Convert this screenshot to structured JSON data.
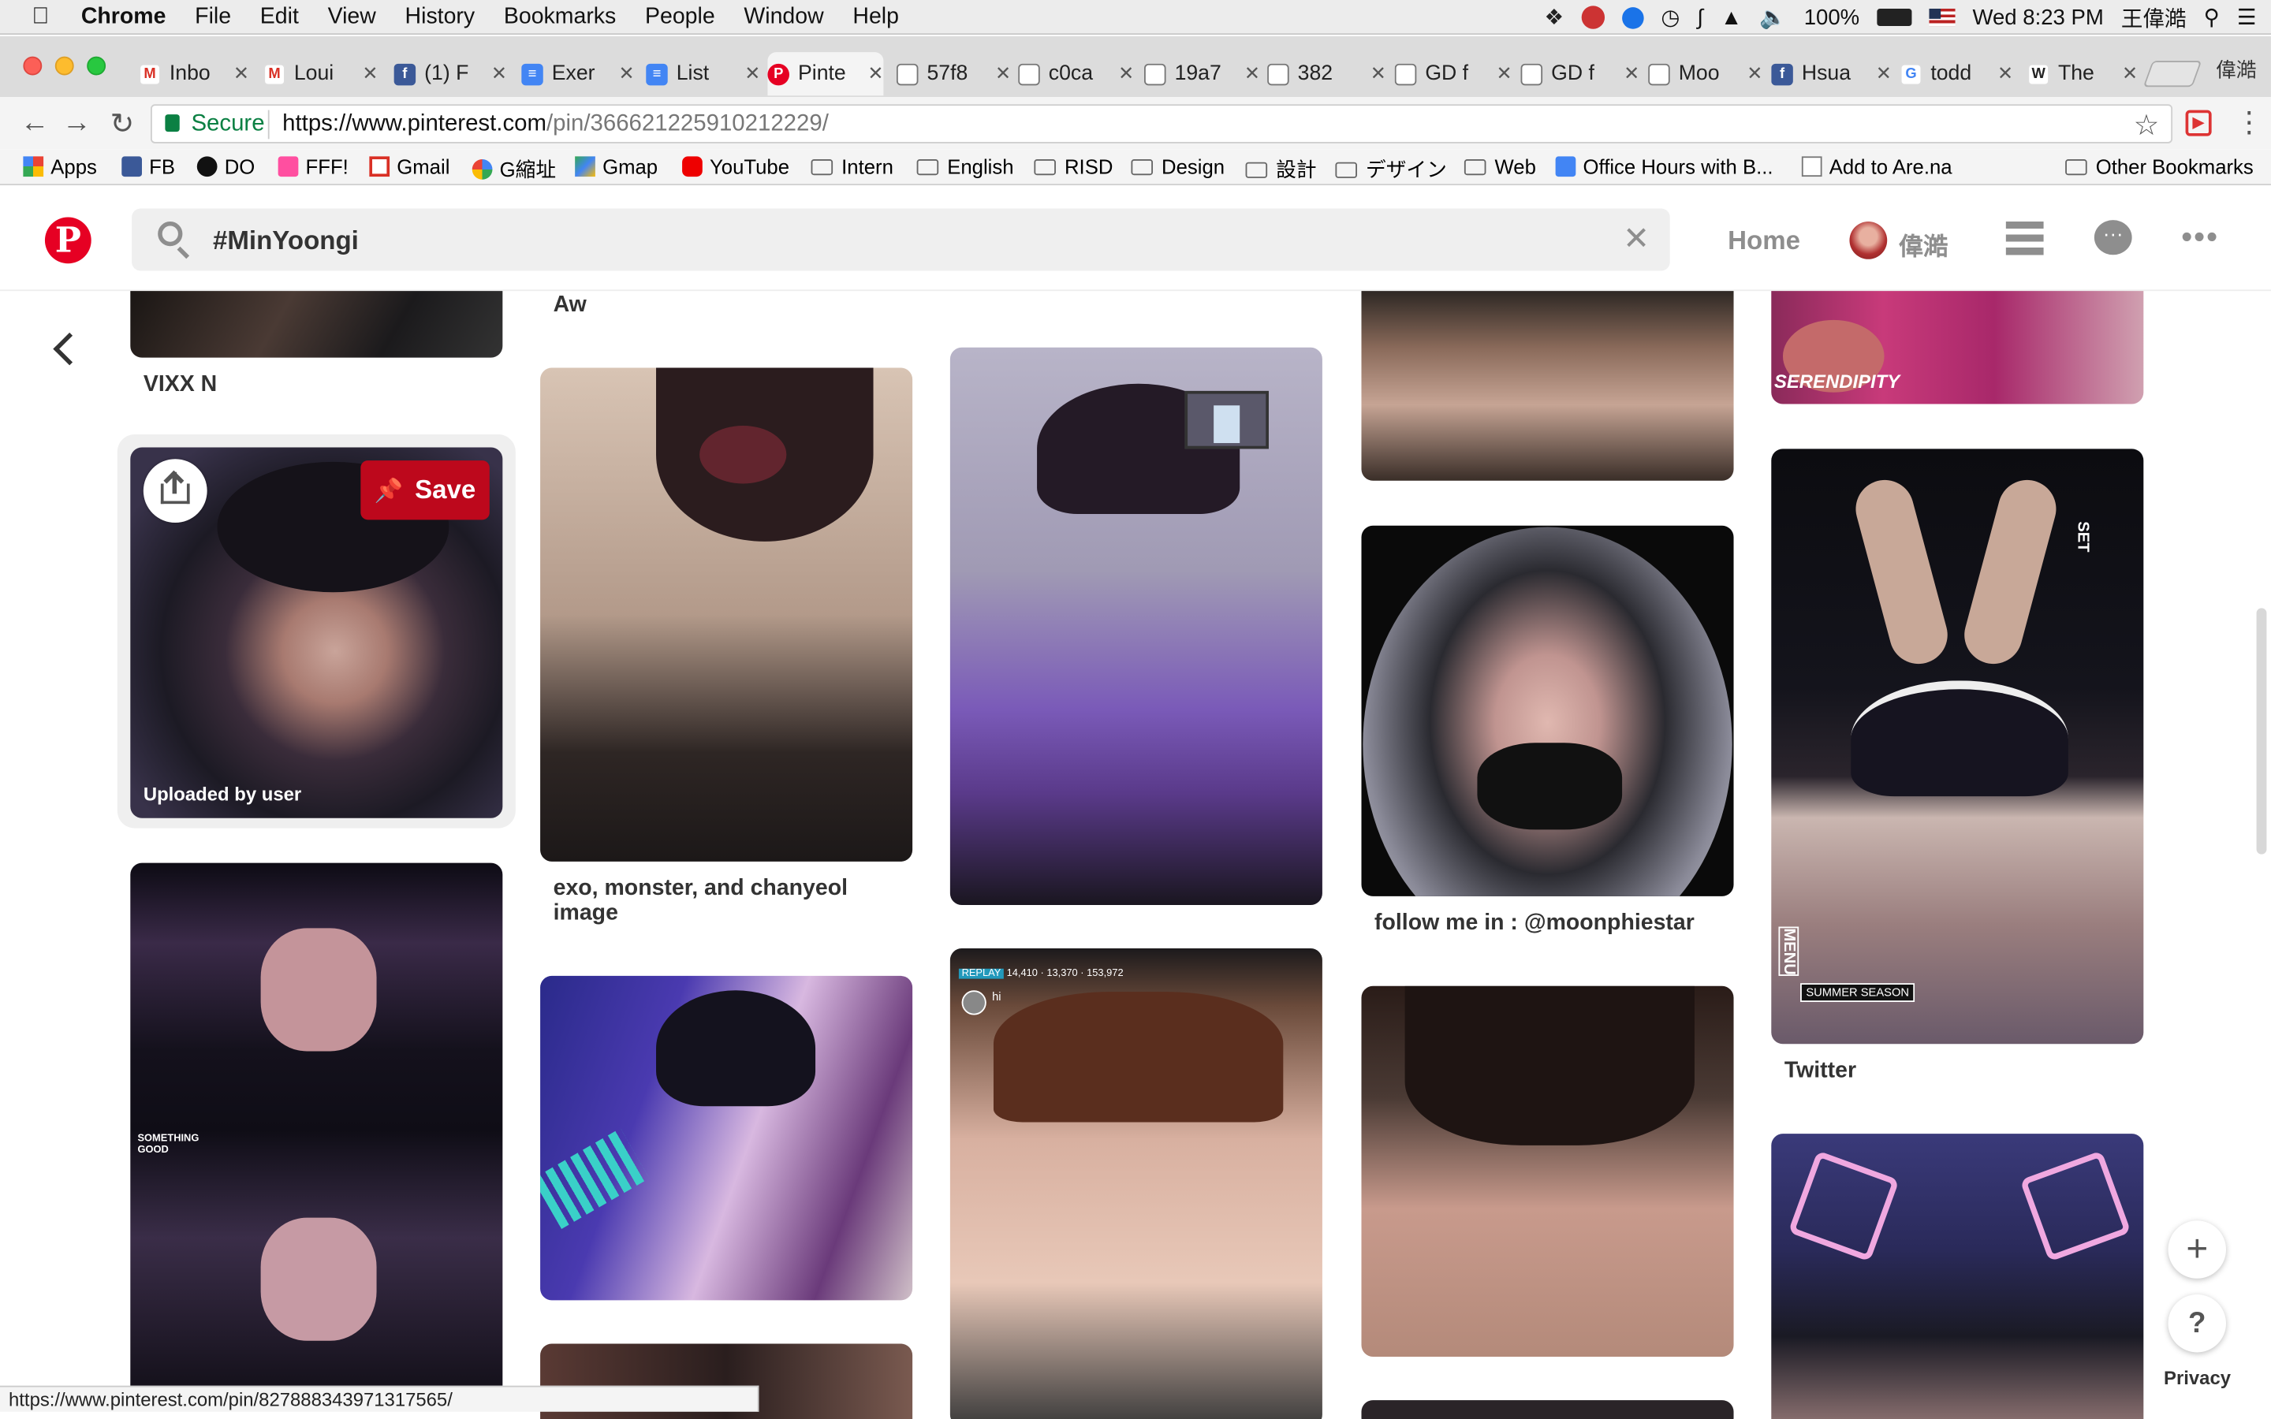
{
  "menubar": {
    "app": "Chrome",
    "items": [
      "File",
      "Edit",
      "View",
      "History",
      "Bookmarks",
      "People",
      "Window",
      "Help"
    ],
    "battery": "100%",
    "clock": "Wed 8:23 PM",
    "user": "王偉澔"
  },
  "tabs": [
    {
      "label": "Inbo",
      "icon": "gmail-icon"
    },
    {
      "label": "Loui",
      "icon": "gmail-icon"
    },
    {
      "label": "(1) F",
      "icon": "facebook-icon"
    },
    {
      "label": "Exer",
      "icon": "docs-icon"
    },
    {
      "label": "List",
      "icon": "docs-icon"
    },
    {
      "label": "Pinte",
      "icon": "pinterest-icon"
    },
    {
      "label": "57f8",
      "icon": "page-icon"
    },
    {
      "label": "c0ca",
      "icon": "page-icon"
    },
    {
      "label": "19a7",
      "icon": "page-icon"
    },
    {
      "label": "382",
      "icon": "page-icon"
    },
    {
      "label": "GD f",
      "icon": "page-icon"
    },
    {
      "label": "GD f",
      "icon": "page-icon"
    },
    {
      "label": "Moo",
      "icon": "page-icon"
    },
    {
      "label": "Hsua",
      "icon": "facebook-icon"
    },
    {
      "label": "todd",
      "icon": "google-icon"
    },
    {
      "label": "The",
      "icon": "wikipedia-icon"
    }
  ],
  "profile_name": "偉澔",
  "address": {
    "secure_label": "Secure",
    "url_host": "https://www.pinterest.com",
    "url_path": "/pin/366621225910212229/"
  },
  "bookmarks": [
    {
      "label": "Apps",
      "icon": "apps-grid-icon"
    },
    {
      "label": "FB",
      "icon": "facebook-icon"
    },
    {
      "label": "DO",
      "icon": "do-icon"
    },
    {
      "label": "FFF!",
      "icon": "fff-icon"
    },
    {
      "label": "Gmail",
      "icon": "gmail-icon"
    },
    {
      "label": "G縮址",
      "icon": "google-icon"
    },
    {
      "label": "Gmap",
      "icon": "maps-icon"
    },
    {
      "label": "YouTube",
      "icon": "youtube-icon"
    },
    {
      "label": "Intern",
      "icon": "folder-icon"
    },
    {
      "label": "English",
      "icon": "folder-icon"
    },
    {
      "label": "RISD",
      "icon": "folder-icon"
    },
    {
      "label": "Design",
      "icon": "folder-icon"
    },
    {
      "label": "設計",
      "icon": "folder-icon"
    },
    {
      "label": "デザイン",
      "icon": "folder-icon"
    },
    {
      "label": "Web",
      "icon": "folder-icon"
    },
    {
      "label": "Office Hours with B...",
      "icon": "docs-icon"
    },
    {
      "label": "Add to Are.na",
      "icon": "page-icon"
    }
  ],
  "other_bookmarks": "Other Bookmarks",
  "pinterest": {
    "search_value": "#MinYoongi",
    "home": "Home",
    "user": "偉澔",
    "save_label": "Save",
    "uploaded_label": "Uploaded by user",
    "captions": {
      "vixx": "VIXX N",
      "aw": "Aw",
      "exo": "exo, monster, and chanyeol image",
      "follow": "follow me in : @moonphiestar",
      "twitter": "Twitter"
    },
    "overlay_texts": {
      "serendipity": "SERENDIPITY",
      "summer": "SUMMER SEASON",
      "set": "SET",
      "menu": "MENU",
      "something": "SOMETHING GOOD",
      "replay": "REPLAY",
      "live_stats": "14,410 · 13,370 · 153,972",
      "hi": "hi"
    },
    "privacy": "Privacy"
  },
  "status_url": "https://www.pinterest.com/pin/827888343971317565/",
  "colors": {
    "pinterest_red": "#e60023",
    "save_red": "#bd081c"
  }
}
